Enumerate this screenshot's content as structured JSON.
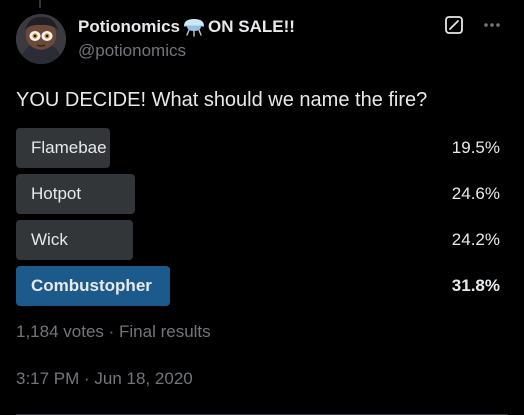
{
  "post": {
    "author": {
      "display_name": "Potionomics",
      "name_suffix": "ON SALE!!",
      "handle": "@potionomics",
      "name_emoji_icon": "flask-emoji-icon"
    },
    "text": "YOU DECIDE! What should we name the fire?",
    "timestamp": "3:17 PM · Jun 18, 2020"
  },
  "poll": {
    "options": [
      {
        "label": "Flamebae",
        "percent_text": "19.5%",
        "percent": 19.5,
        "winner": false
      },
      {
        "label": "Hotpot",
        "percent_text": "24.6%",
        "percent": 24.6,
        "winner": false
      },
      {
        "label": "Wick",
        "percent_text": "24.2%",
        "percent": 24.2,
        "winner": false
      },
      {
        "label": "Combustopher",
        "percent_text": "31.8%",
        "percent": 31.8,
        "winner": true
      }
    ],
    "summary": "1,184 votes · Final results"
  },
  "icons": {
    "grok": "grok-icon",
    "more": "more-icon"
  },
  "colors": {
    "background": "#000000",
    "text_primary": "#e7e9ea",
    "text_secondary": "#71767b",
    "poll_bar": "#333639",
    "poll_bar_winner": "#1d5a8c"
  }
}
